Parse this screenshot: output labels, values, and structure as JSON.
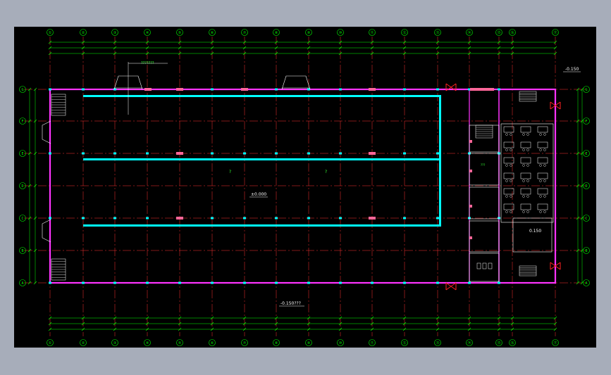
{
  "drawing": {
    "x_axes": [
      "①",
      "②",
      "③",
      "④",
      "⑤",
      "⑥",
      "⑦",
      "⑧",
      "⑨",
      "⑩",
      "⑪",
      "⑫",
      "⑬",
      "⑭",
      "⑮",
      "⑯",
      "⑰"
    ],
    "y_axes": [
      "G",
      "F",
      "E",
      "D",
      "C",
      "B",
      "A"
    ],
    "annotations": {
      "level_outside_top": "-0.150",
      "level_floor": "±0.000",
      "level_outside_bottom": "-0.150???",
      "level_stair": "0.150",
      "equipment_note": "???????",
      "hall_mark_1": "?",
      "hall_mark_2": "?",
      "room_mark": "???"
    },
    "colors": {
      "background": "#000000",
      "outer_wall": "#ff33ff",
      "rail_beam": "#00ffff",
      "grid": "#ff3333",
      "dimension": "#00ff00",
      "annotation": "#ffffff",
      "stairs": "#ffffff",
      "door_symbol": "#ff2222",
      "window": "#ff6699"
    }
  }
}
